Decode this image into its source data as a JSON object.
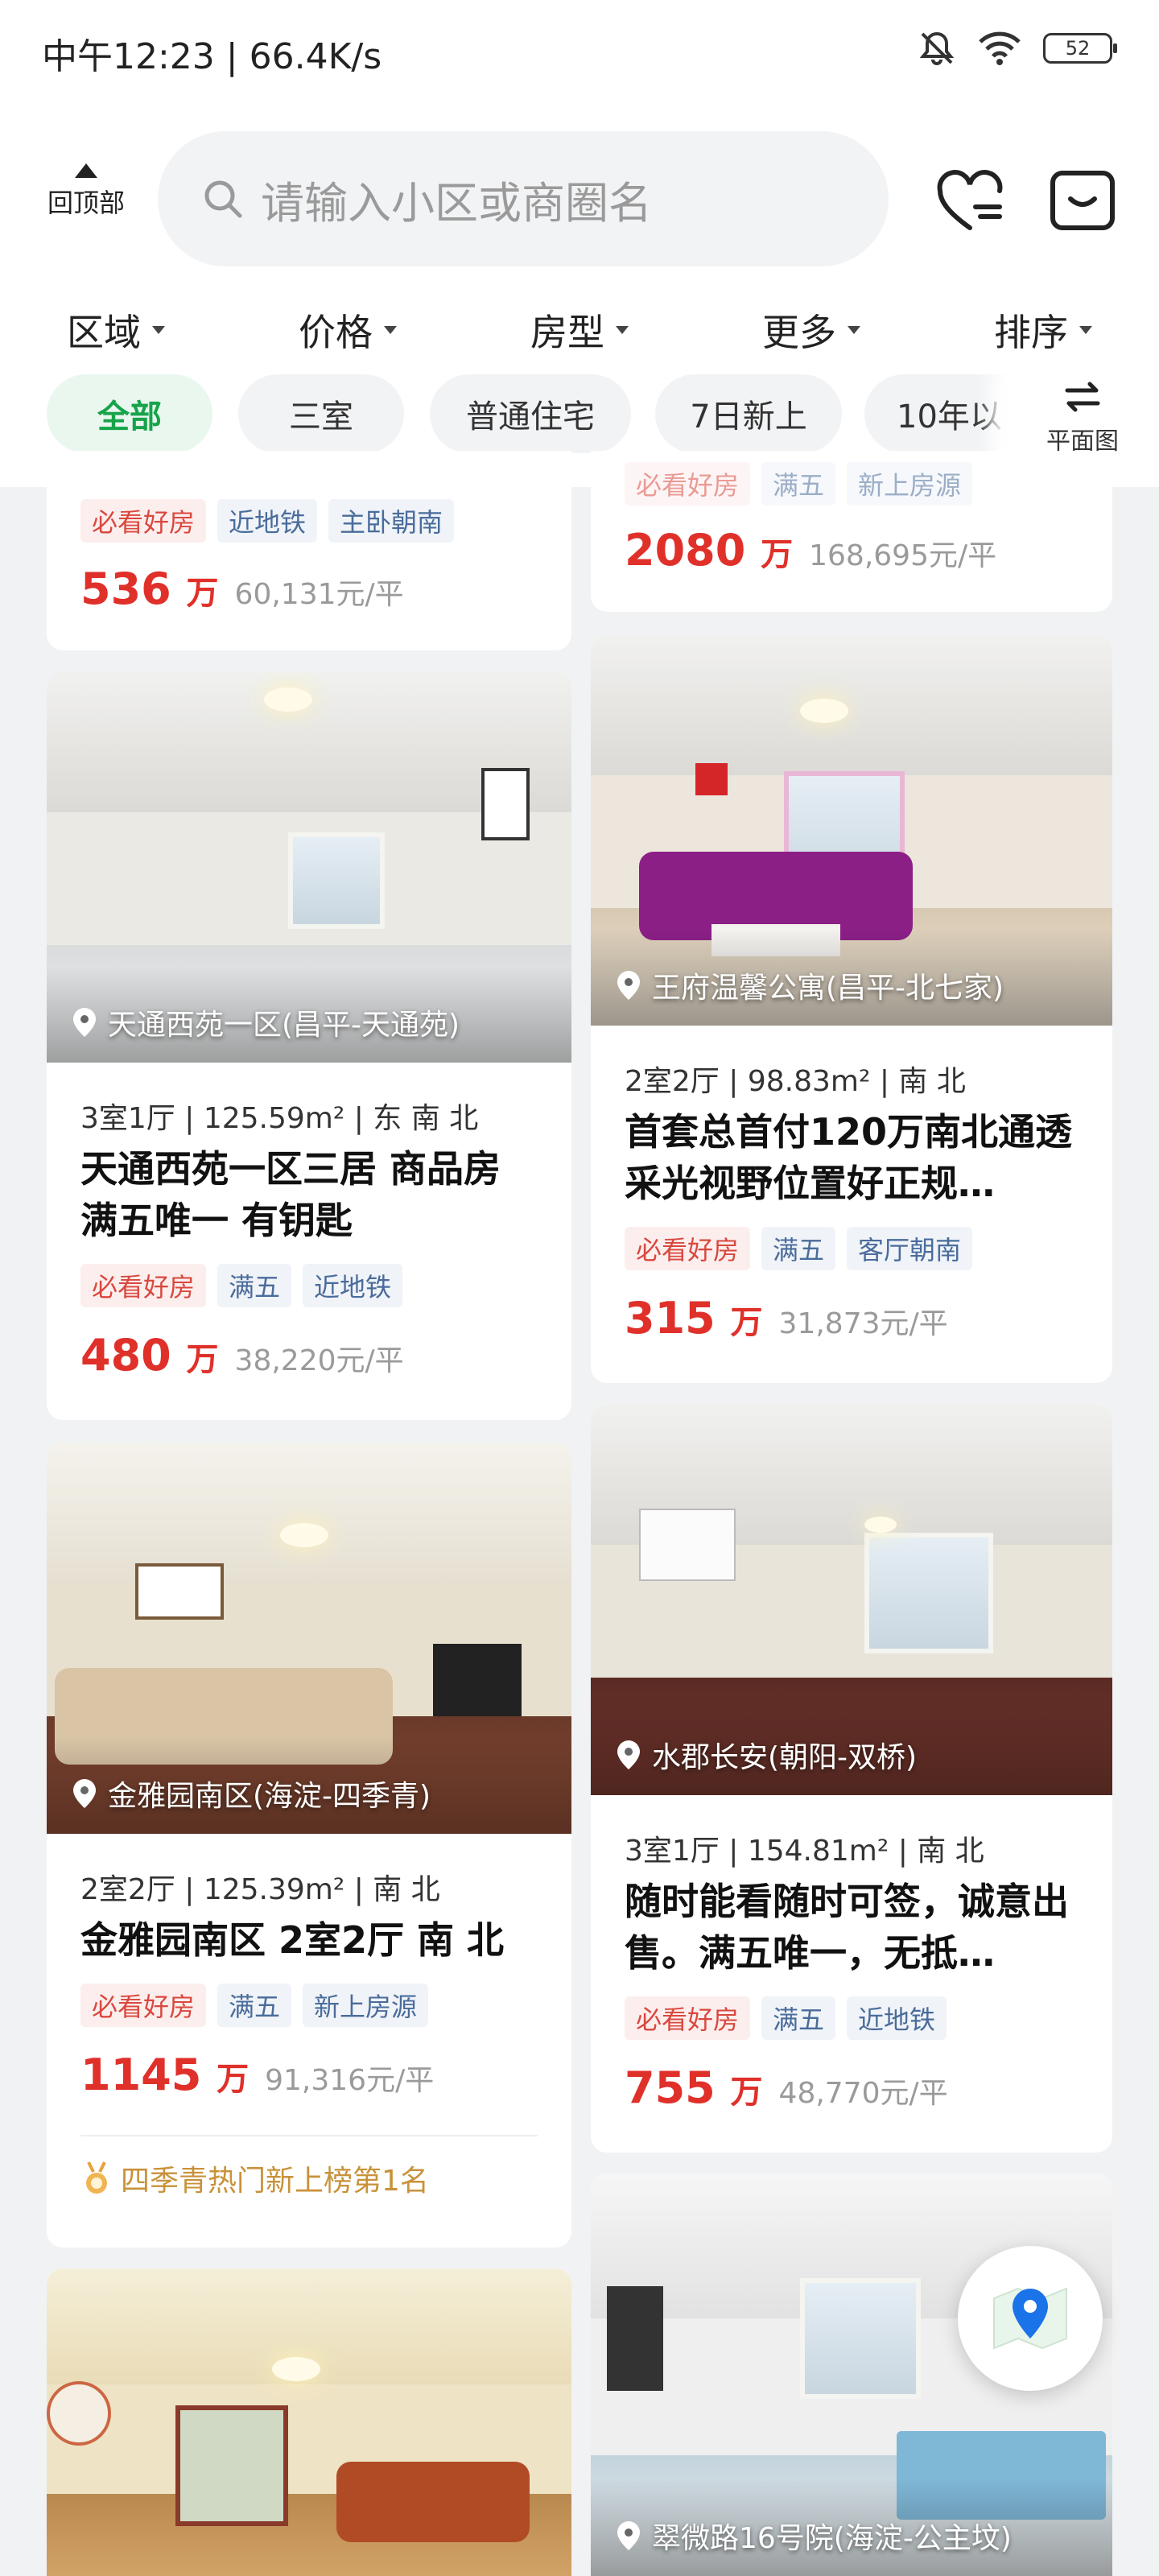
{
  "status_bar": {
    "time": "中午12:23 | 66.4K/s",
    "battery": "52"
  },
  "header": {
    "back_to_top": "回顶部",
    "search_placeholder": "请输入小区或商圈名",
    "filters": [
      "区域",
      "价格",
      "房型",
      "更多",
      "排序"
    ],
    "chips": [
      "全部",
      "三室",
      "普通住宅",
      "7日新上",
      "10年以"
    ],
    "floorplan_label": "平面图"
  },
  "listings": {
    "c0": {
      "tags": [
        "必看好房",
        "近地铁",
        "主卧朝南"
      ],
      "price": "536",
      "price_unit": "万",
      "unit_price": "60,131元/平"
    },
    "c1": {
      "tags": [
        "必看好房",
        "满五",
        "新上房源"
      ],
      "price": "2080",
      "price_unit": "万",
      "unit_price": "168,695元/平"
    },
    "c2": {
      "location": "天通西苑一区(昌平-天通苑)",
      "meta": "3室1厅 | 125.59m² | 东 南 北",
      "title": "天通西苑一区三居 商品房 满五唯一 有钥匙",
      "tags": [
        "必看好房",
        "满五",
        "近地铁"
      ],
      "price": "480",
      "price_unit": "万",
      "unit_price": "38,220元/平"
    },
    "c3": {
      "location": "王府温馨公寓(昌平-北七家)",
      "meta": "2室2厅 | 98.83m² | 南 北",
      "title": "首套总首付120万南北通透采光视野位置好正规…",
      "tags": [
        "必看好房",
        "满五",
        "客厅朝南"
      ],
      "price": "315",
      "price_unit": "万",
      "unit_price": "31,873元/平"
    },
    "c4": {
      "location": "金雅园南区(海淀-四季青)",
      "meta": "2室2厅 | 125.39m² | 南 北",
      "title": "金雅园南区 2室2厅 南 北",
      "tags": [
        "必看好房",
        "满五",
        "新上房源"
      ],
      "price": "1145",
      "price_unit": "万",
      "unit_price": "91,316元/平",
      "rank": "四季青热门新上榜第1名"
    },
    "c5": {
      "location": "水郡长安(朝阳-双桥)",
      "meta": "3室1厅 | 154.81m² | 南 北",
      "title": "随时能看随时可签，诚意出售。满五唯一，无抵…",
      "tags": [
        "必看好房",
        "满五",
        "近地铁"
      ],
      "price": "755",
      "price_unit": "万",
      "unit_price": "48,770元/平"
    },
    "c7": {
      "location": "翠微路16号院(海淀-公主坟)"
    }
  },
  "colors": {
    "price": "#e0302a",
    "active_chip": "#17a34a",
    "map_pin": "#1a73e8"
  }
}
